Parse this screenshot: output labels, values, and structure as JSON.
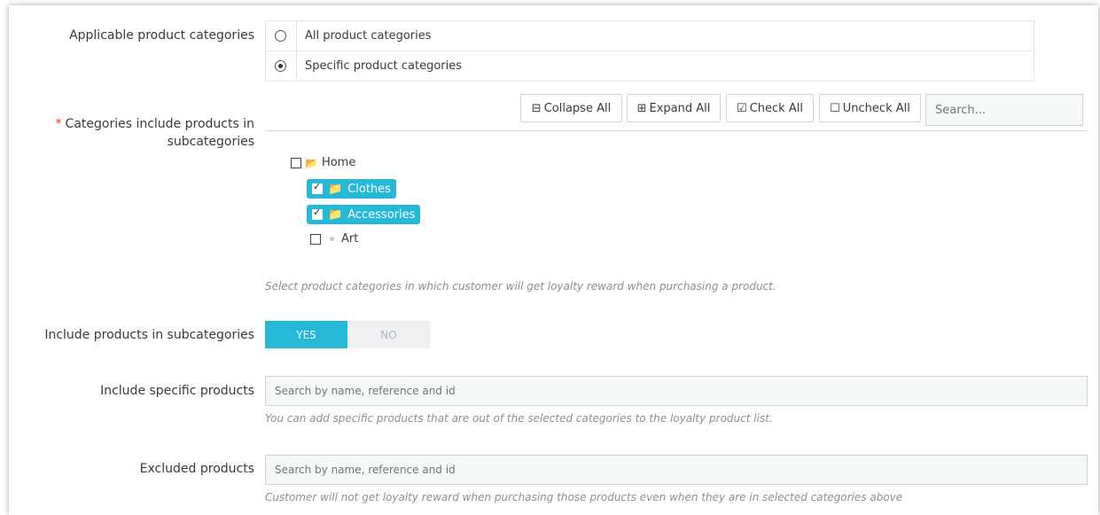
{
  "applicable": {
    "label": "Applicable product categories",
    "options": [
      {
        "label": "All product categories",
        "selected": false
      },
      {
        "label": "Specific product categories",
        "selected": true
      }
    ]
  },
  "categories": {
    "required_mark": "*",
    "label_line1": "Categories include products in",
    "label_line2": "subcategories",
    "toolbar": {
      "collapse": "Collapse All",
      "expand": "Expand All",
      "check": "Check All",
      "uncheck": "Uncheck All",
      "search_placeholder": "Search..."
    },
    "tree": [
      {
        "label": "Home",
        "checked": false,
        "type": "folder-open"
      },
      {
        "label": "Clothes",
        "checked": true,
        "type": "folder"
      },
      {
        "label": "Accessories",
        "checked": true,
        "type": "folder"
      },
      {
        "label": "Art",
        "checked": false,
        "type": "leaf"
      }
    ],
    "help": "Select product categories in which customer will get loyalty reward when purchasing a product."
  },
  "subcategories_switch": {
    "label": "Include products in subcategories",
    "yes": "YES",
    "no": "NO",
    "value": "YES"
  },
  "include_specific": {
    "label": "Include specific products",
    "placeholder": "Search by name, reference and id",
    "help": "You can add specific products that are out of the selected categories to the loyalty product list."
  },
  "excluded": {
    "label": "Excluded products",
    "placeholder": "Search by name, reference and id",
    "help": "Customer will not get loyalty reward when purchasing those products even when they are in selected categories above"
  },
  "colors": {
    "accent": "#25b9d7",
    "required": "#ee3333",
    "help_text": "#8a9097"
  }
}
